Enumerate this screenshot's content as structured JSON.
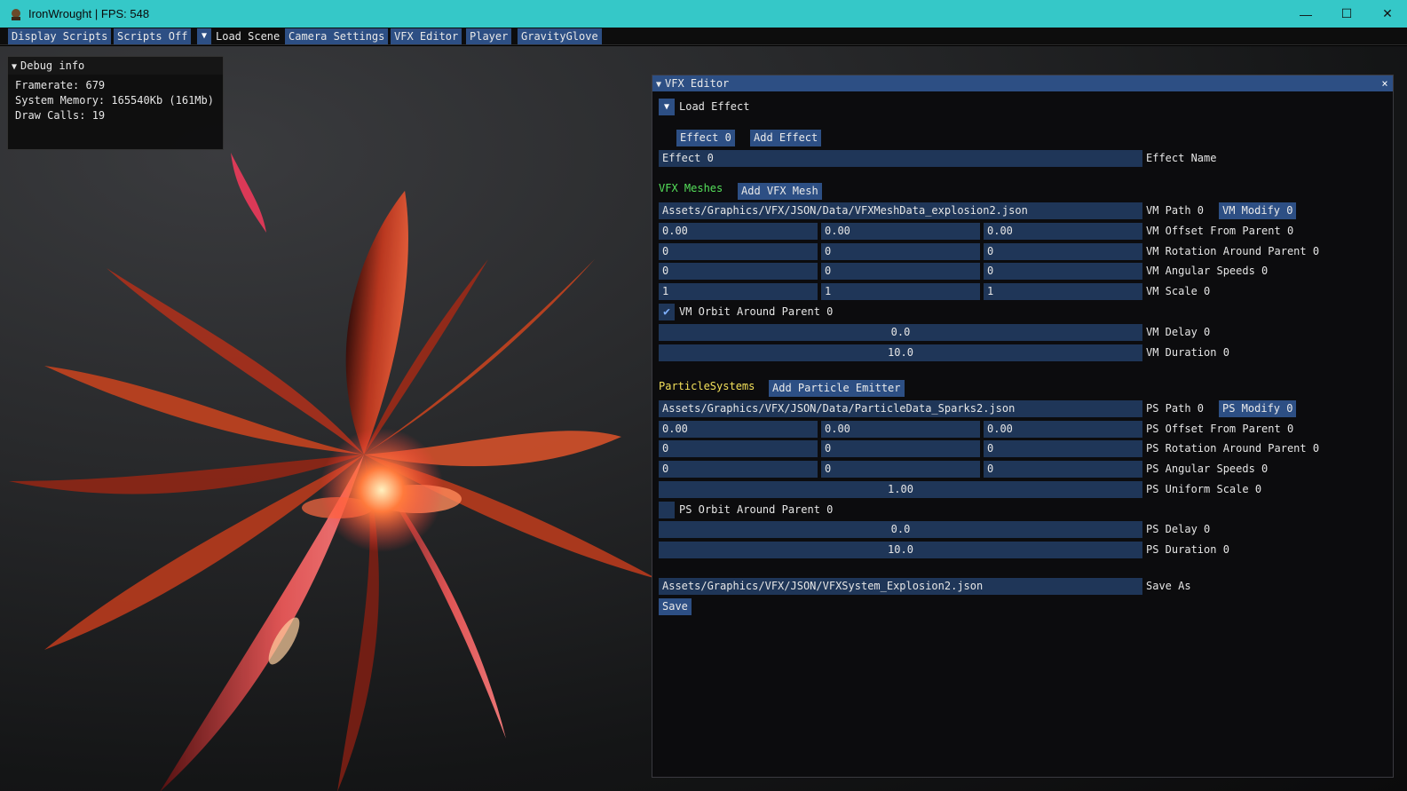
{
  "window": {
    "title": "IronWrought | FPS: 548",
    "controls": {
      "minimize": "—",
      "maximize": "☐",
      "close": "✕"
    }
  },
  "menubar": {
    "display_scripts": "Display Scripts",
    "scripts_off": "Scripts Off",
    "load_scene_arrow": "▼",
    "load_scene": "Load Scene",
    "camera_settings": "Camera Settings",
    "vfx_editor": "VFX Editor",
    "player": "Player",
    "gravity_glove": "GravityGlove"
  },
  "debug": {
    "title": "Debug info",
    "framerate": "Framerate: 679",
    "memory": "System Memory: 165540Kb (161Mb)",
    "draw_calls": "Draw Calls: 19"
  },
  "vfx_editor": {
    "title": "VFX Editor",
    "close": "×",
    "load_effect": "Load Effect",
    "effect_tab": "Effect 0",
    "add_effect": "Add Effect",
    "effect_name_value": "Effect 0",
    "effect_name_label": "Effect Name",
    "vfx_meshes": {
      "header": "VFX Meshes",
      "add_button": "Add VFX Mesh",
      "path_value": "Assets/Graphics/VFX/JSON/Data/VFXMeshData_explosion2.json",
      "path_label": "VM Path 0",
      "modify_button": "VM Modify 0",
      "offset": [
        "0.00",
        "0.00",
        "0.00"
      ],
      "offset_label": "VM Offset From Parent 0",
      "rotation": [
        "0",
        "0",
        "0"
      ],
      "rotation_label": "VM Rotation Around Parent 0",
      "angular": [
        "0",
        "0",
        "0"
      ],
      "angular_label": "VM Angular Speeds 0",
      "scale": [
        "1",
        "1",
        "1"
      ],
      "scale_label": "VM Scale 0",
      "orbit_checked": "✔",
      "orbit_label": "VM Orbit Around Parent 0",
      "delay": "0.0",
      "delay_label": "VM Delay 0",
      "duration": "10.0",
      "duration_label": "VM Duration 0"
    },
    "particle_systems": {
      "header": "ParticleSystems",
      "add_button": "Add Particle Emitter",
      "path_value": "Assets/Graphics/VFX/JSON/Data/ParticleData_Sparks2.json",
      "path_label": "PS Path 0",
      "modify_button": "PS Modify 0",
      "offset": [
        "0.00",
        "0.00",
        "0.00"
      ],
      "offset_label": "PS Offset From Parent 0",
      "rotation": [
        "0",
        "0",
        "0"
      ],
      "rotation_label": "PS Rotation Around Parent 0",
      "angular": [
        "0",
        "0",
        "0"
      ],
      "angular_label": "PS Angular Speeds 0",
      "uniform_scale": "1.00",
      "uniform_scale_label": "PS Uniform Scale 0",
      "orbit_label": "PS Orbit Around Parent 0",
      "delay": "0.0",
      "delay_label": "PS Delay 0",
      "duration": "10.0",
      "duration_label": "PS Duration 0"
    },
    "save_path": "Assets/Graphics/VFX/JSON/VFXSystem_Explosion2.json",
    "save_as_label": "Save As",
    "save_button": "Save"
  },
  "colors": {
    "titlebar": "#35c8c8",
    "button": "#2d4f84",
    "field": "#1f3658",
    "section_green": "#55e05a",
    "section_yellow": "#f3e05a"
  }
}
